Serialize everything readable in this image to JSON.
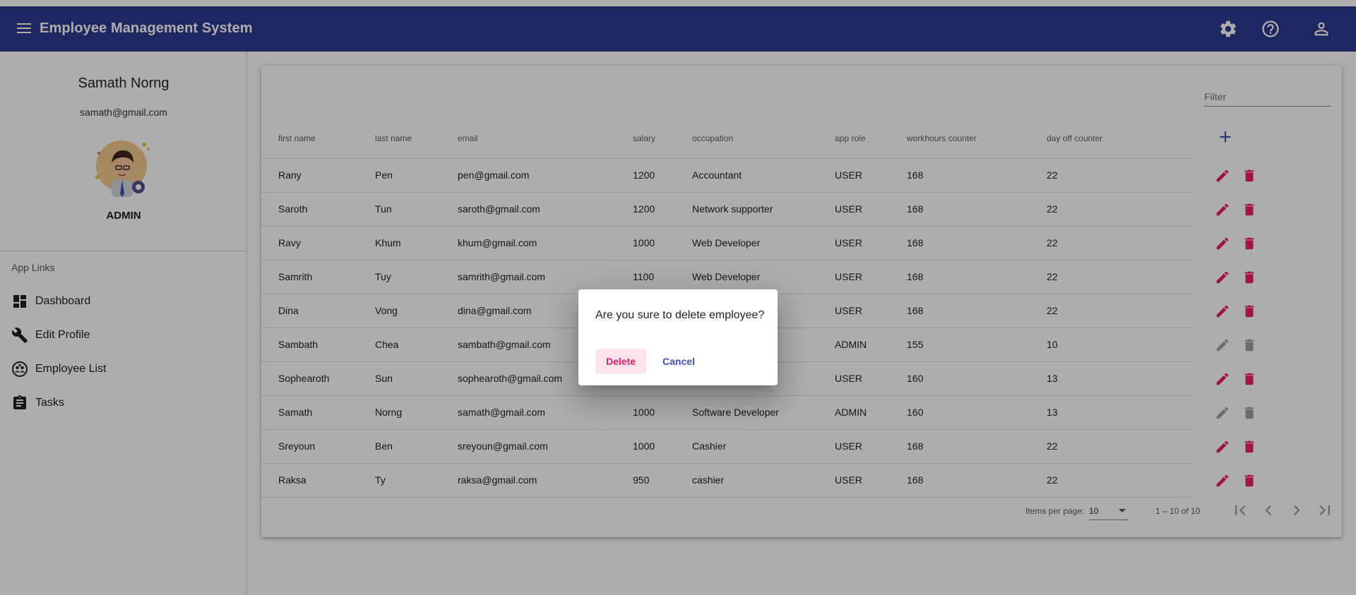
{
  "app": {
    "title": "Employee Management System"
  },
  "toolbar": {
    "icons": [
      "menu-icon",
      "settings-icon",
      "help-icon",
      "account-icon"
    ]
  },
  "user": {
    "name": "Samath Norng",
    "email": "samath@gmail.com",
    "role": "ADMIN"
  },
  "sidebar": {
    "header": "App Links",
    "items": [
      {
        "label": "Dashboard",
        "icon": "dashboard-icon"
      },
      {
        "label": "Edit Profile",
        "icon": "wrench-icon"
      },
      {
        "label": "Employee List",
        "icon": "group-icon"
      },
      {
        "label": "Tasks",
        "icon": "clipboard-icon"
      }
    ]
  },
  "filter": {
    "placeholder": "Filter"
  },
  "table": {
    "columns": [
      "first name",
      "last name",
      "email",
      "salary",
      "occupation",
      "app role",
      "workhours counter",
      "day off counter"
    ],
    "rows": [
      [
        "Rany",
        "Pen",
        "pen@gmail.com",
        "1200",
        "Accountant",
        "USER",
        "168",
        "22"
      ],
      [
        "Saroth",
        "Tun",
        "saroth@gmail.com",
        "1200",
        "Network supporter",
        "USER",
        "168",
        "22"
      ],
      [
        "Ravy",
        "Khum",
        "khum@gmail.com",
        "1000",
        "Web Developer",
        "USER",
        "168",
        "22"
      ],
      [
        "Samrith",
        "Tuy",
        "samrith@gmail.com",
        "1100",
        "Web Developer",
        "USER",
        "168",
        "22"
      ],
      [
        "Dina",
        "Vong",
        "dina@gmail.com",
        "",
        "",
        "USER",
        "168",
        "22"
      ],
      [
        "Sambath",
        "Chea",
        "sambath@gmail.com",
        "",
        "",
        "ADMIN",
        "155",
        "10"
      ],
      [
        "Sophearoth",
        "Sun",
        "sophearoth@gmail.com",
        "",
        "",
        "USER",
        "160",
        "13"
      ],
      [
        "Samath",
        "Norng",
        "samath@gmail.com",
        "1000",
        "Software Developer",
        "ADMIN",
        "160",
        "13"
      ],
      [
        "Sreyoun",
        "Ben",
        "sreyoun@gmail.com",
        "1000",
        "Cashier",
        "USER",
        "168",
        "22"
      ],
      [
        "Raksa",
        "Ty",
        "raksa@gmail.com",
        "950",
        "cashier",
        "USER",
        "168",
        "22"
      ]
    ],
    "row_actions_enabled": [
      true,
      true,
      true,
      true,
      true,
      false,
      true,
      false,
      true,
      true
    ]
  },
  "paginator": {
    "items_per_page_label": "Items per page:",
    "items_per_page": "10",
    "range": "1 – 10 of 10"
  },
  "dialog": {
    "message": "Are you sure to delete employee?",
    "delete_label": "Delete",
    "cancel_label": "Cancel"
  },
  "colors": {
    "toolbar": "#2f3a8f",
    "accent": "#e91e63",
    "primary": "#3f51b5",
    "disabled": "#9e9e9e"
  }
}
